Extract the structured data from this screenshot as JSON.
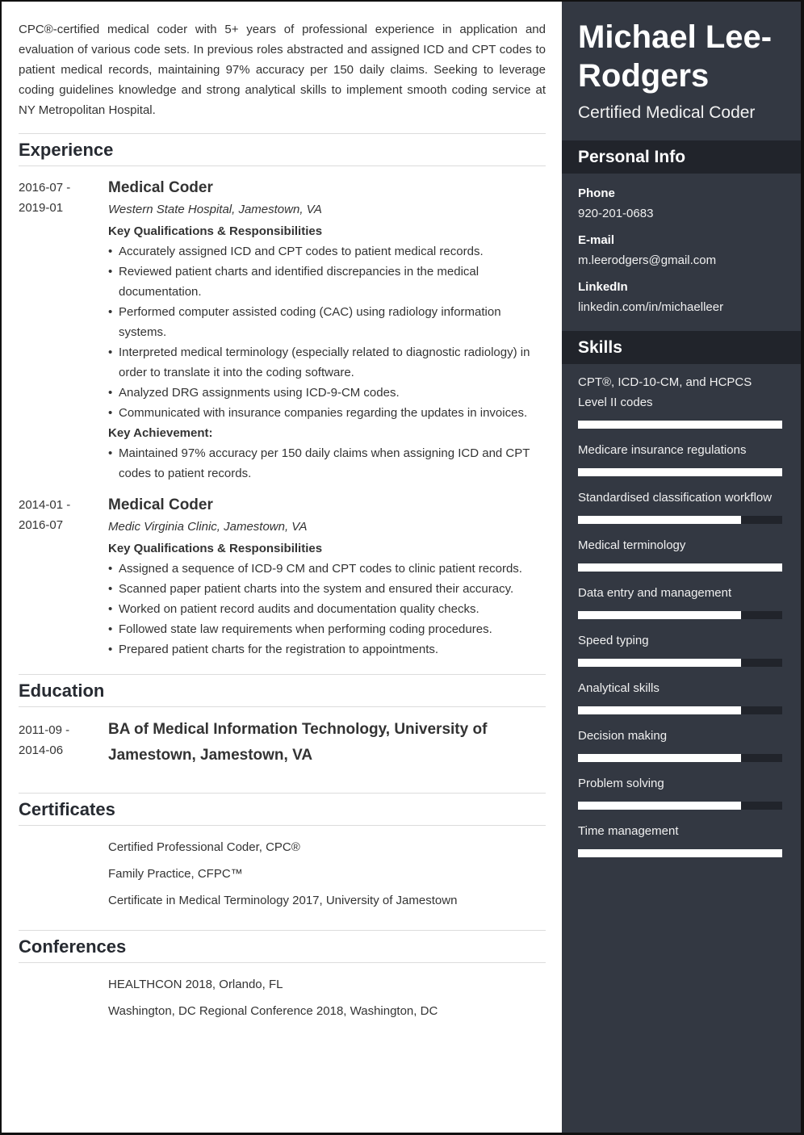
{
  "summary": "CPC®-certified medical coder with 5+ years of professional experience in application and evaluation of various code sets. In previous roles abstracted and assigned ICD and CPT codes to patient medical records, maintaining 97% accuracy per 150 daily claims. Seeking to leverage coding guidelines knowledge and strong analytical skills to implement smooth coding service at NY Metropolitan Hospital.",
  "sections": {
    "experience": "Experience",
    "education": "Education",
    "certificates": "Certificates",
    "conferences": "Conferences"
  },
  "experience": [
    {
      "date_start": "2016-07 -",
      "date_end": "2019-01",
      "title": "Medical Coder",
      "company": "Western State Hospital, Jamestown, VA",
      "resp_heading": "Key Qualifications & Responsibilities",
      "responsibilities": [
        "Accurately assigned ICD and CPT codes to patient medical records.",
        "Reviewed patient charts and identified discrepancies in the medical documentation.",
        "Performed computer assisted coding (CAC) using radiology information systems.",
        "Interpreted medical terminology (especially related to diagnostic radiology) in order to translate it into the coding software.",
        "Analyzed DRG assignments using ICD-9-CM codes.",
        "Communicated with insurance companies regarding the updates in invoices."
      ],
      "achievement_heading": "Key Achievement:",
      "achievements": [
        "Maintained 97% accuracy per 150 daily claims when assigning ICD and CPT codes to patient records."
      ]
    },
    {
      "date_start": "2014-01 -",
      "date_end": "2016-07",
      "title": "Medical Coder",
      "company": "Medic Virginia Clinic, Jamestown, VA",
      "resp_heading": "Key Qualifications & Responsibilities",
      "responsibilities": [
        "Assigned a sequence of ICD-9 CM and CPT codes to clinic patient records.",
        "Scanned paper patient charts into the system and ensured their accuracy.",
        "Worked on patient record audits and documentation quality checks.",
        "Followed state law requirements when performing coding procedures.",
        "Prepared patient charts for the registration to appointments."
      ]
    }
  ],
  "education": [
    {
      "date_start": "2011-09 -",
      "date_end": "2014-06",
      "title": "BA of Medical Information Technology,  University of Jamestown, Jamestown, VA"
    }
  ],
  "certificates": [
    "Certified Professional Coder, CPC®",
    "Family Practice, CFPC™",
    "Certificate in Medical Terminology 2017, University of Jamestown"
  ],
  "conferences": [
    "HEALTHCON 2018, Orlando, FL",
    "Washington, DC Regional Conference 2018, Washington, DC"
  ],
  "sidebar": {
    "name": "Michael Lee-Rodgers",
    "role": "Certified Medical Coder",
    "personal_info_title": "Personal Info",
    "phone_label": "Phone",
    "phone": "920-201-0683",
    "email_label": "E-mail",
    "email": "m.leerodgers@gmail.com",
    "linkedin_label": "LinkedIn",
    "linkedin": "linkedin.com/in/michaelleer",
    "skills_title": "Skills",
    "skills": [
      {
        "name": "CPT®, ICD-10-CM, and HCPCS Level II codes",
        "level": 1.0
      },
      {
        "name": "Medicare insurance regulations",
        "level": 1.0
      },
      {
        "name": "Standardised classification workflow",
        "level": 0.8
      },
      {
        "name": "Medical terminology",
        "level": 1.0
      },
      {
        "name": "Data entry and management",
        "level": 0.8
      },
      {
        "name": "Speed typing",
        "level": 0.8
      },
      {
        "name": "Analytical skills",
        "level": 0.8
      },
      {
        "name": "Decision making",
        "level": 0.8
      },
      {
        "name": "Problem solving",
        "level": 0.8
      },
      {
        "name": "Time management",
        "level": 1.0
      }
    ]
  },
  "colors": {
    "sidebar_bg": "#333842",
    "sidebar_band": "#21242b",
    "skill_fill": "#ffffff",
    "text": "#333333"
  }
}
